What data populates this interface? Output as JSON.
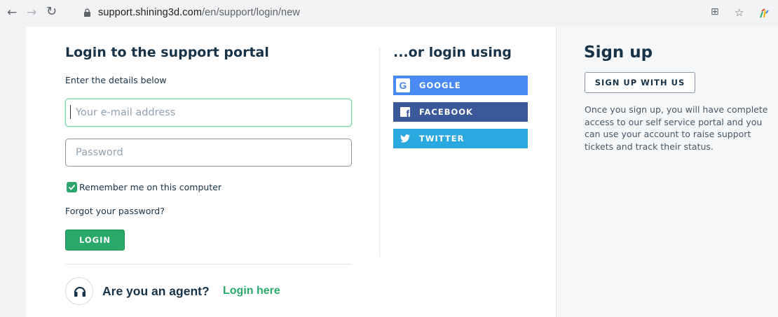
{
  "browser": {
    "url_host": "support.shining3d.com",
    "url_path": "/en/support/login/new",
    "back_icon": "back-arrow-icon",
    "forward_icon": "forward-arrow-icon",
    "reload_icon": "reload-icon"
  },
  "login": {
    "title": "Login to the support portal",
    "subtitle": "Enter the details below",
    "email_placeholder": "Your e-mail address",
    "password_placeholder": "Password",
    "remember_label": "Remember me on this computer",
    "remember_checked": true,
    "forgot_link": "Forgot your password?",
    "login_button": "LOGIN"
  },
  "agent": {
    "question": "Are you an agent?",
    "link": "Login here"
  },
  "social": {
    "title": "...or login using",
    "google": "GOOGLE",
    "facebook": "FACEBOOK",
    "twitter": "TWITTER"
  },
  "signup": {
    "title": "Sign up",
    "button": "SIGN UP WITH US",
    "description": "Once you sign up, you will have complete access to our self service portal and you can use your account to raise support tickets and track their status."
  },
  "colors": {
    "accent_green": "#2aaa6a",
    "google_blue": "#4a8af4",
    "facebook_blue": "#3b5898",
    "twitter_blue": "#2aa9e0",
    "heading_navy": "#183247"
  }
}
